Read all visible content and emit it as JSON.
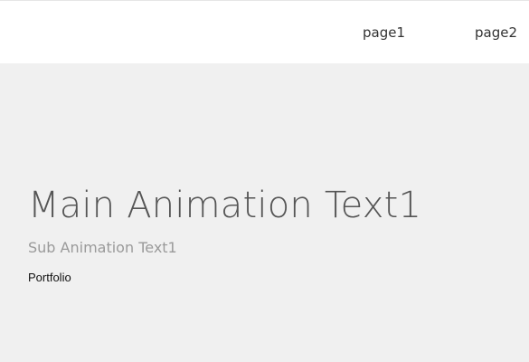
{
  "header": {
    "nav": {
      "page1_label": "page1",
      "page2_label": "page2"
    }
  },
  "hero": {
    "main_title": "Main Animation Text1",
    "sub_title": "Sub Animation Text1",
    "portfolio_label": "Portfolio"
  },
  "colors": {
    "header_bg": "#ffffff",
    "hero_bg": "#f0f0f0",
    "main_title": "#555555",
    "sub_title": "#9a9a9a",
    "link": "#111111"
  }
}
